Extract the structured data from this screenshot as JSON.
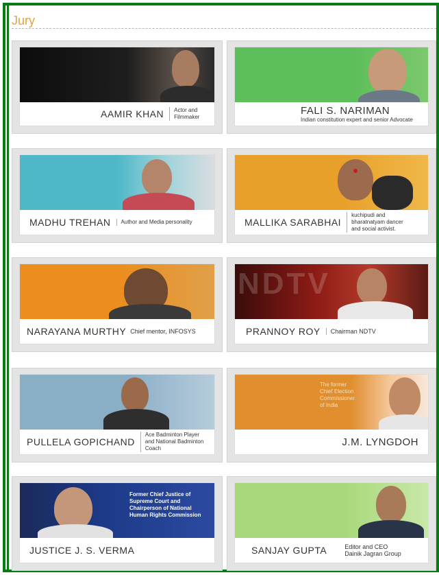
{
  "section": {
    "title": "Jury"
  },
  "jury": [
    {
      "name": "AAMIR KHAN",
      "desc_lines": [
        "Actor and",
        "Filmmaker"
      ],
      "band_color": "#1a1a1a"
    },
    {
      "name": "FALI S. NARIMAN",
      "desc_lines": [
        "Indian constitution expert and senior Advocate"
      ],
      "band_color": "#5dbf5a"
    },
    {
      "name": "MADHU TREHAN",
      "desc_lines": [
        "Author and Media personality"
      ],
      "band_color": "#4fb8c8"
    },
    {
      "name": "MALLIKA SARABHAI",
      "desc_lines": [
        "kuchipudi and",
        "bharatnatyam dancer",
        "and social activist."
      ],
      "band_color": "#e8a02a"
    },
    {
      "name": "NARAYANA MURTHY",
      "desc_lines": [
        "Chief mentor, INFOSYS"
      ],
      "band_color": "#ec8d1e"
    },
    {
      "name": "PRANNOY ROY",
      "desc_lines": [
        "Chairman NDTV"
      ],
      "band_color": "#8a1a14",
      "band_text": "NDTV"
    },
    {
      "name": "PULLELA GOPICHAND",
      "desc_lines": [
        "Ace Badminton Player",
        "and National Badminton",
        "Coach"
      ],
      "band_color": "#8aaec6"
    },
    {
      "name": "J.M. LYNGDOH",
      "desc_lines": [],
      "band_color": "#e08e2e",
      "band_overlay_lines": [
        "The former",
        "Chief Election",
        "Commissioner",
        "of India"
      ]
    },
    {
      "name": "JUSTICE J. S. VERMA",
      "desc_lines": [],
      "band_color": "#1d3a8a",
      "band_overlay_lines": [
        "Former Chief Justice of",
        "Supreme Court and",
        "Chairperson of National",
        "Human Rights Commission"
      ]
    },
    {
      "name": "SANJAY GUPTA",
      "desc_lines": [
        "Editor and CEO",
        "Dainik Jagran Group"
      ],
      "band_color": "#a8d87a"
    }
  ]
}
